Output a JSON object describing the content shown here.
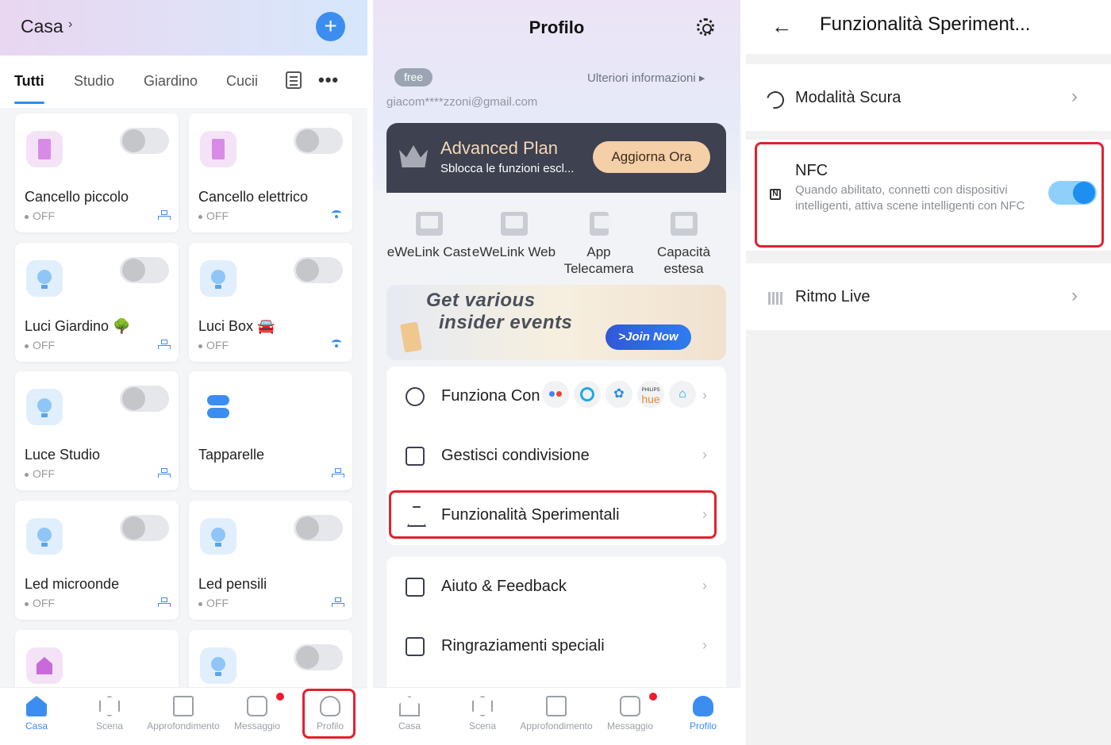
{
  "panel1": {
    "home_title": "Casa",
    "tabs": [
      "Tutti",
      "Studio",
      "Giardino",
      "Cucii"
    ],
    "devices": [
      {
        "name": "Cancello piccolo",
        "status": "OFF",
        "icon": "door-icon",
        "toggle": "off",
        "conn": "network-icon"
      },
      {
        "name": "Cancello elettrico",
        "status": "OFF",
        "icon": "door-icon",
        "toggle": "off",
        "conn": "wifi-icon"
      },
      {
        "name": "Luci Giardino 🌳",
        "status": "OFF",
        "icon": "bulb-icon",
        "toggle": "off",
        "conn": "network-icon"
      },
      {
        "name": "Luci Box 🚘",
        "status": "OFF",
        "icon": "bulb-icon",
        "toggle": "off",
        "conn": "wifi-icon"
      },
      {
        "name": "Luce Studio",
        "status": "OFF",
        "icon": "bulb-icon",
        "toggle": "off",
        "conn": "network-icon"
      },
      {
        "name": "Tapparelle",
        "status": "",
        "icon": "blinds-icon",
        "toggle": "none",
        "conn": "network-icon"
      },
      {
        "name": "Led microonde",
        "status": "OFF",
        "icon": "bulb-icon",
        "toggle": "off",
        "conn": "network-icon"
      },
      {
        "name": "Led pensili",
        "status": "OFF",
        "icon": "bulb-icon",
        "toggle": "off",
        "conn": "network-icon"
      },
      {
        "name": "",
        "status": "",
        "icon": "thermo-house-icon",
        "toggle": "none",
        "conn": ""
      },
      {
        "name": "",
        "status": "",
        "icon": "bulb-icon",
        "toggle": "off",
        "conn": ""
      }
    ],
    "nav": [
      {
        "label": "Casa",
        "active": true
      },
      {
        "label": "Scena",
        "active": false
      },
      {
        "label": "Approfondimento",
        "active": false
      },
      {
        "label": "Messaggio",
        "active": false
      },
      {
        "label": "Profilo",
        "active": false
      }
    ]
  },
  "panel2": {
    "title": "Profilo",
    "badge": "free",
    "more_info": "Ulteriori informazioni ▸",
    "email": "giacom****zzoni@gmail.com",
    "plan": {
      "title": "Advanced Plan",
      "subtitle": "Sblocca le funzioni escl...",
      "button": "Aggiorna Ora"
    },
    "tools": [
      "eWeLink Cast",
      "eWeLink Web",
      "App Telecamera",
      "Capacità estesa"
    ],
    "banner": {
      "line1": "Get various",
      "line2": "insider events",
      "button": ">Join Now"
    },
    "menu": [
      "Funziona Con",
      "Gestisci condivisione",
      "Funzionalità Sperimentali",
      "Aiuto & Feedback",
      "Ringraziamenti speciali"
    ],
    "partners": [
      "google-assistant-icon",
      "alexa-icon",
      "smartthings-icon",
      "philips-hue-icon",
      "home-icon"
    ],
    "hue_label_top": "PHILIPS",
    "hue_label": "hue",
    "nav": [
      {
        "label": "Casa",
        "active": false
      },
      {
        "label": "Scena",
        "active": false
      },
      {
        "label": "Approfondimento",
        "active": false
      },
      {
        "label": "Messaggio",
        "active": false
      },
      {
        "label": "Profilo",
        "active": true
      }
    ]
  },
  "panel3": {
    "title": "Funzionalità Speriment...",
    "dark_mode": "Modalità Scura",
    "nfc_title": "NFC",
    "nfc_desc": "Quando abilitato, connetti con dispositivi intelligenti, attiva scene intelligenti con NFC",
    "nfc_enabled": true,
    "rhythm": "Ritmo Live"
  },
  "colors": {
    "accent": "#3b8ef0",
    "highlight": "#e0222f",
    "plan_bg": "#3d4150",
    "upgrade_btn": "#f4cfa7"
  }
}
